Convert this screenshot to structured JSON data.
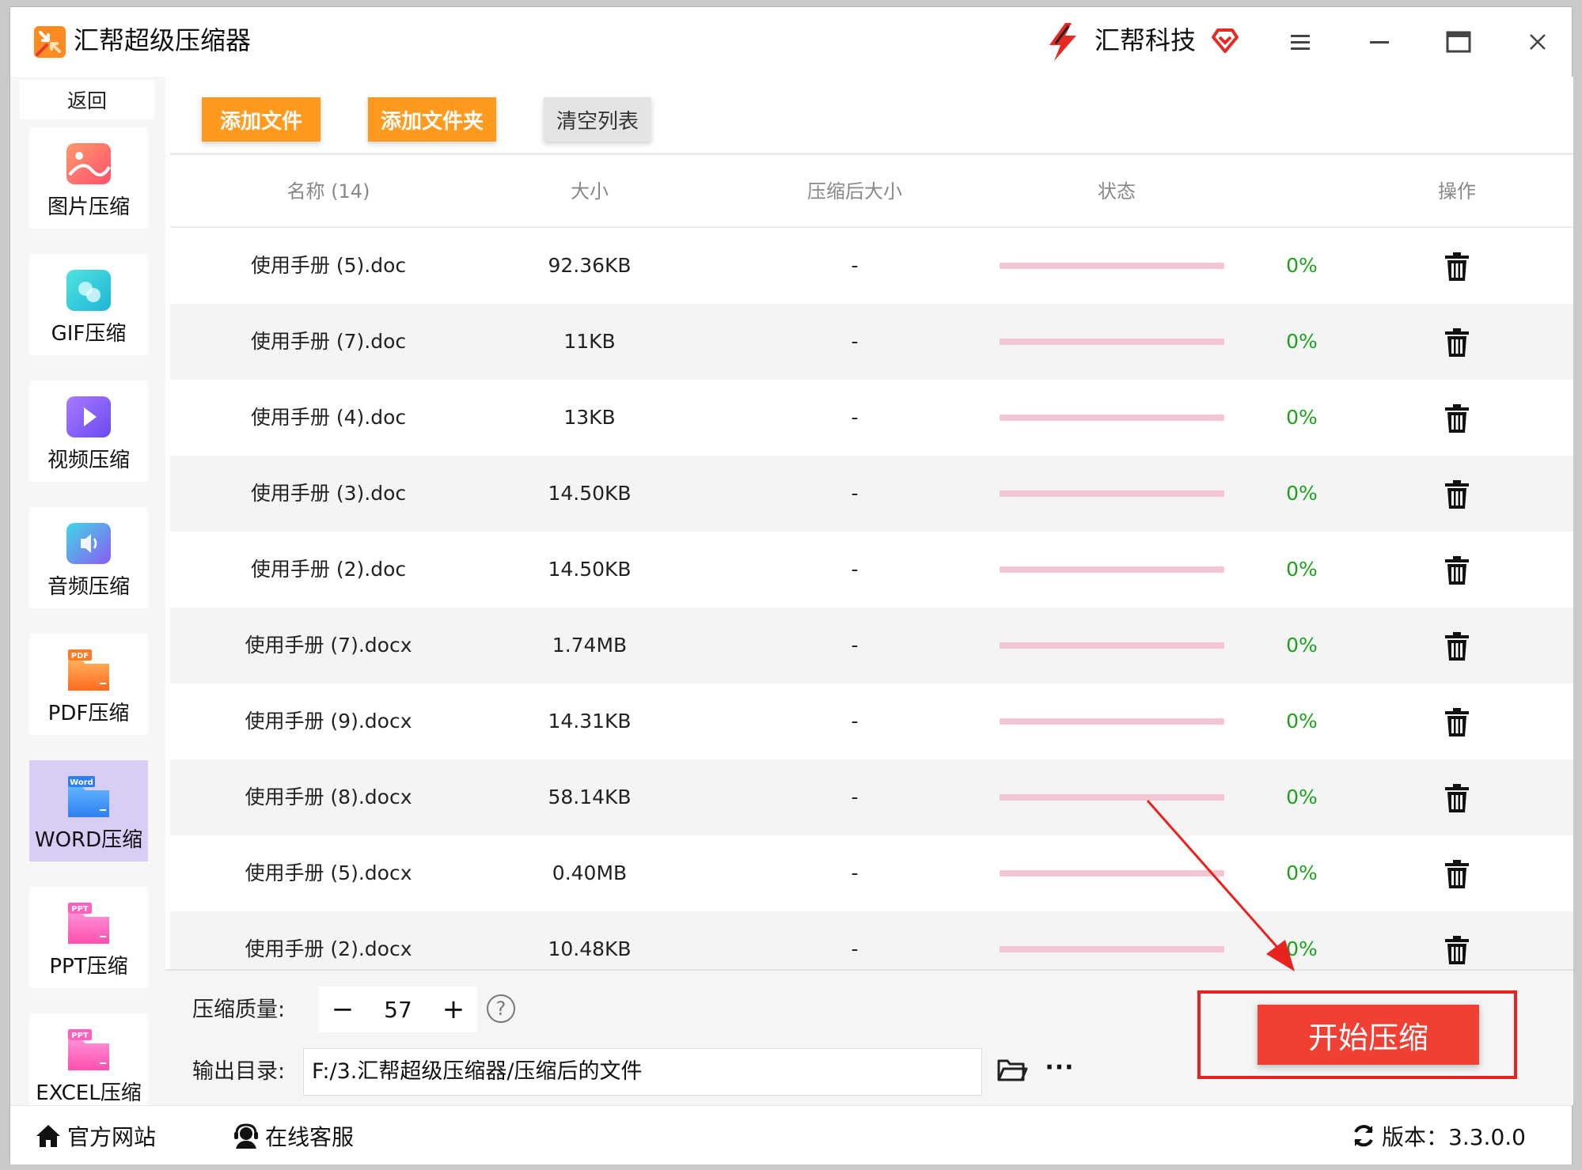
{
  "app": {
    "title": "汇帮超级压缩器",
    "brand": "汇帮科技"
  },
  "window_controls": [
    "menu-icon",
    "minimize-icon",
    "maximize-icon",
    "close-icon"
  ],
  "sidebar": {
    "back_label": "返回",
    "items": [
      {
        "label": "图片压缩",
        "icon": "image-compress-icon"
      },
      {
        "label": "GIF压缩",
        "icon": "gif-compress-icon"
      },
      {
        "label": "视频压缩",
        "icon": "video-compress-icon"
      },
      {
        "label": "音频压缩",
        "icon": "audio-compress-icon"
      },
      {
        "label": "PDF压缩",
        "icon": "pdf-compress-icon",
        "badge": "PDF"
      },
      {
        "label": "WORD压缩",
        "icon": "word-compress-icon",
        "badge": "Word",
        "active": true
      },
      {
        "label": "PPT压缩",
        "icon": "ppt-compress-icon",
        "badge": "PPT"
      },
      {
        "label": "EXCEL压缩",
        "icon": "excel-compress-icon",
        "badge": "PPT"
      }
    ]
  },
  "toolbar": {
    "add_file": "添加文件",
    "add_folder": "添加文件夹",
    "clear_list": "清空列表"
  },
  "table": {
    "headers": {
      "name": "名称 (14)",
      "size": "大小",
      "compressed_size": "压缩后大小",
      "status": "状态",
      "action": "操作"
    },
    "rows": [
      {
        "name": "使用手册 (5).doc",
        "size": "92.36KB",
        "compressed": "-",
        "progress": "0%",
        "progress_value": 0
      },
      {
        "name": "使用手册 (7).doc",
        "size": "11KB",
        "compressed": "-",
        "progress": "0%",
        "progress_value": 0
      },
      {
        "name": "使用手册 (4).doc",
        "size": "13KB",
        "compressed": "-",
        "progress": "0%",
        "progress_value": 0
      },
      {
        "name": "使用手册 (3).doc",
        "size": "14.50KB",
        "compressed": "-",
        "progress": "0%",
        "progress_value": 0
      },
      {
        "name": "使用手册 (2).doc",
        "size": "14.50KB",
        "compressed": "-",
        "progress": "0%",
        "progress_value": 0
      },
      {
        "name": "使用手册 (7).docx",
        "size": "1.74MB",
        "compressed": "-",
        "progress": "0%",
        "progress_value": 0
      },
      {
        "name": "使用手册 (9).docx",
        "size": "14.31KB",
        "compressed": "-",
        "progress": "0%",
        "progress_value": 0
      },
      {
        "name": "使用手册 (8).docx",
        "size": "58.14KB",
        "compressed": "-",
        "progress": "0%",
        "progress_value": 0
      },
      {
        "name": "使用手册 (5).docx",
        "size": "0.40MB",
        "compressed": "-",
        "progress": "0%",
        "progress_value": 0
      },
      {
        "name": "使用手册 (2).docx",
        "size": "10.48KB",
        "compressed": "-",
        "progress": "0%",
        "progress_value": 0
      }
    ]
  },
  "settings": {
    "quality_label": "压缩质量:",
    "quality_value": "57",
    "quality_minus": "−",
    "quality_plus": "+",
    "help": "?",
    "output_label": "输出目录:",
    "output_path": "F:/3.汇帮超级压缩器/压缩后的文件",
    "more": "···"
  },
  "start_button": "开始压缩",
  "footer": {
    "website": "官方网站",
    "support": "在线客服",
    "version": "版本：3.3.0.0"
  },
  "colors": {
    "orange": "#ff9a1f",
    "start_red": "#f04034",
    "highlight_red": "#e8231f",
    "progress_track": "#f4c6d2",
    "progress_text": "#1aa31a",
    "active_sidebar": "#d8cdf5"
  }
}
